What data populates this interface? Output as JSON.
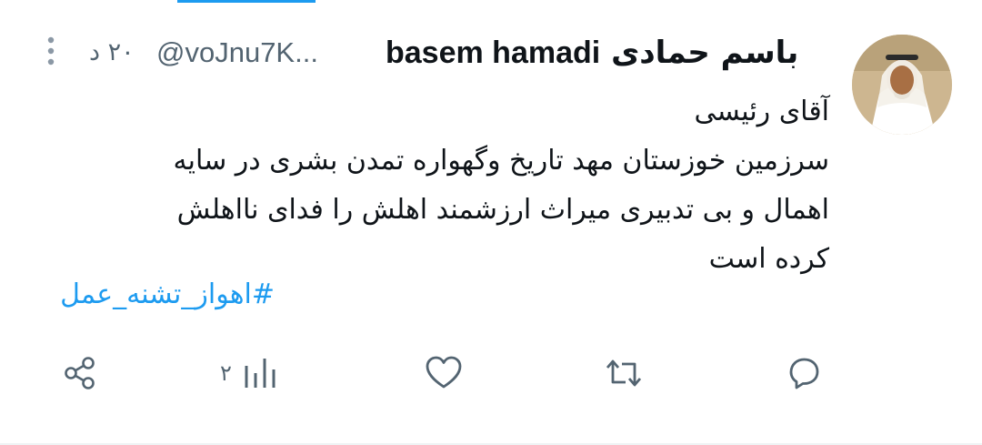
{
  "tweet": {
    "author_name_arabic": "باسم حمادی",
    "author_name_latin": "basem hamadi",
    "handle": "@voJnu7K...",
    "time": "٢٠ د",
    "lines": [
      "آقای رئیسی",
      "سرزمین خوزستان  مهد  تاریخ وگهواره تمدن بشری در سایه",
      "اهمال و بی تدبیری میراث ارزشمند اهلش را فدای نااهلش",
      "کرده است"
    ],
    "hashtag": "#اهواز_تشنه_عمل"
  },
  "actions": {
    "views_count": "٢"
  },
  "colors": {
    "accent": "#1d9bf0",
    "secondary_text": "#536471",
    "primary_text": "#0f1419"
  }
}
